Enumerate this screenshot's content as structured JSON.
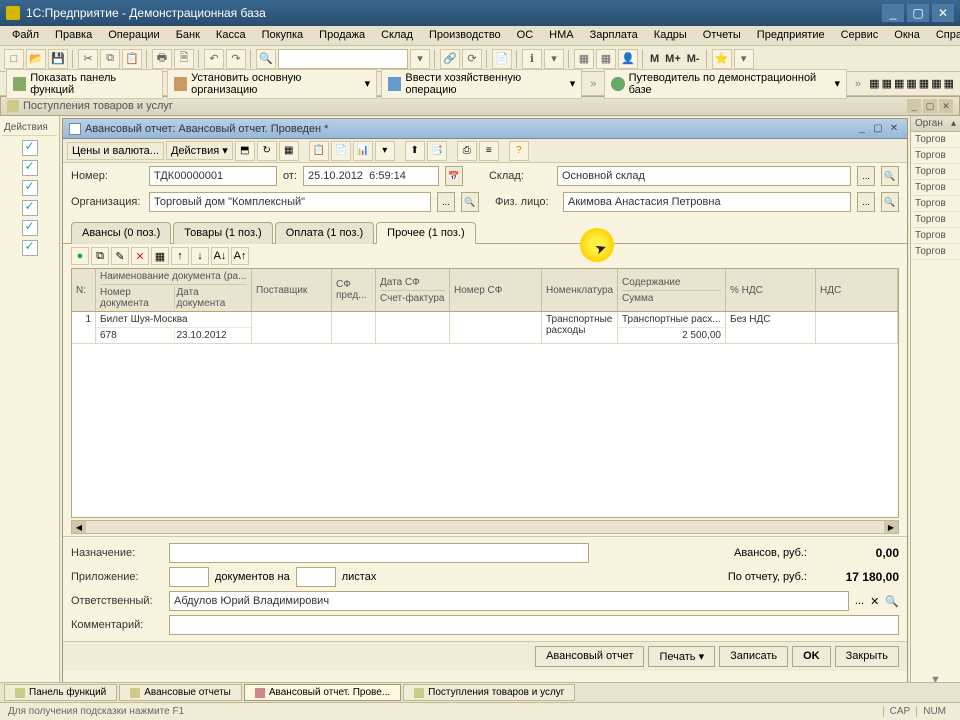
{
  "titlebar": {
    "text": "1С:Предприятие - Демонстрационная база"
  },
  "menu": [
    "Файл",
    "Правка",
    "Операции",
    "Банк",
    "Касса",
    "Покупка",
    "Продажа",
    "Склад",
    "Производство",
    "ОС",
    "НМА",
    "Зарплата",
    "Кадры",
    "Отчеты",
    "Предприятие",
    "Сервис",
    "Окна",
    "Справка"
  ],
  "toolbar_letters": {
    "m": "M",
    "mplus": "M+",
    "mminus": "M-"
  },
  "funcbar": {
    "show_panel": "Показать панель функций",
    "set_org": "Установить основную организацию",
    "enter_op": "Ввести хозяйственную операцию",
    "guide": "Путеводитель по демонстрационной базе"
  },
  "subwin_top": {
    "title": "Поступления товаров и услуг"
  },
  "leftcol_hdr": "Действия",
  "doc_title": "Авансовый отчет: Авансовый отчет. Проведен *",
  "doc_toolbar": {
    "prices": "Цены и валюта...",
    "actions": "Действия"
  },
  "form": {
    "number_lbl": "Номер:",
    "number": "ТДК00000001",
    "from_lbl": "от:",
    "date": "25.10.2012  6:59:14",
    "sklad_lbl": "Склад:",
    "sklad": "Основной склад",
    "org_lbl": "Организация:",
    "org": "Торговый дом \"Комплексный\"",
    "person_lbl": "Физ. лицо:",
    "person": "Акимова Анастасия Петровна"
  },
  "tabs": [
    "Авансы (0 поз.)",
    "Товары (1 поз.)",
    "Оплата (1 поз.)",
    "Прочее (1 поз.)"
  ],
  "active_tab": 3,
  "grid_headers": {
    "n": "N:",
    "name": "Наименование документа (ра...",
    "num_doc": "Номер документа",
    "date_doc": "Дата документа",
    "supplier": "Поставщик",
    "sf": "СФ пред...",
    "date_sf": "Дата СФ",
    "invoice": "Счет-фактура",
    "num_sf": "Номер СФ",
    "nomenclature": "Номенклатура",
    "content": "Содержание",
    "sum": "Сумма",
    "vat_pct": "% НДС",
    "vat": "НДС"
  },
  "grid_row": {
    "n": "1",
    "name": "Билет Шуя-Москва",
    "num_doc": "678",
    "date_doc": "23.10.2012",
    "supplier": "",
    "sf": "",
    "date_sf": "",
    "num_sf": "",
    "nomenclature": "Транспортные расходы",
    "content": "Транспортные расх...",
    "sum": "2 500,00",
    "vat_pct": "Без НДС",
    "vat": ""
  },
  "bottom": {
    "naz_lbl": "Назначение:",
    "pril_lbl": "Приложение:",
    "docs_on": "документов на",
    "sheets": "листах",
    "resp_lbl": "Ответственный:",
    "resp": "Абдулов Юрий Владимирович",
    "comm_lbl": "Комментарий:",
    "avans_lbl": "Авансов, руб.:",
    "avans_val": "0,00",
    "report_lbl": "По отчету, руб.:",
    "report_val": "17 180,00"
  },
  "buttons": {
    "report": "Авансовый отчет",
    "print": "Печать",
    "write": "Записать",
    "ok": "OK",
    "close": "Закрыть"
  },
  "rightcol": {
    "hdr": "Орган",
    "items": [
      "Торгов",
      "Торгов",
      "Торгов",
      "Торгов",
      "Торгов",
      "Торгов",
      "Торгов",
      "Торгов"
    ]
  },
  "taskbar": {
    "panel": "Панель функций",
    "reports": "Авансовые отчеты",
    "current": "Авансовый отчет. Прове...",
    "incoming": "Поступления товаров и услуг"
  },
  "status": {
    "text": "Для получения подсказки нажмите F1",
    "cap": "CAP",
    "num": "NUM"
  }
}
